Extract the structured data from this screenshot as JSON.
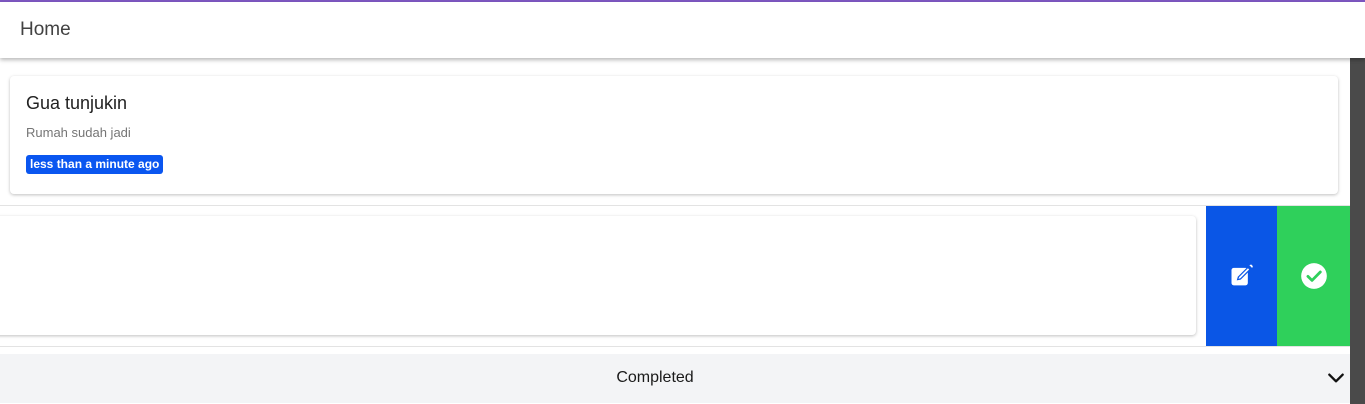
{
  "header": {
    "title": "Home"
  },
  "todos": [
    {
      "title": "Gua tunjukin",
      "description": "Rumah sudah jadi",
      "time": "less than a minute ago"
    }
  ],
  "swipe_actions": {
    "edit_icon": "edit-icon",
    "complete_icon": "check-circle-icon"
  },
  "completed_section": {
    "label": "Completed",
    "icon": "chevron-down-icon"
  },
  "colors": {
    "accent": "#7e57c2",
    "badge": "#0a56f0",
    "edit_action": "#0a56e6",
    "complete_action": "#2fd05b"
  }
}
